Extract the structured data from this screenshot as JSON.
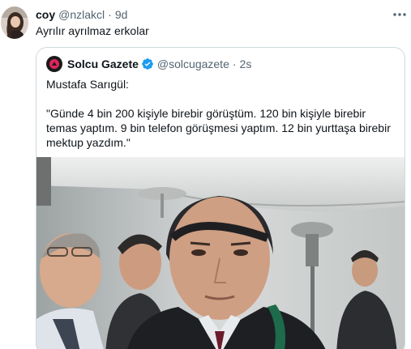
{
  "tweet": {
    "display_name": "coy",
    "handle": "@nzlakcl",
    "separator": "·",
    "time": "9d",
    "text": "Ayrılır ayrılmaz erkolar"
  },
  "quoted": {
    "display_name": "Solcu Gazete",
    "handle": "@solcugazete",
    "separator": "·",
    "time": "2s",
    "speaker": "Mustafa Sarıgül:",
    "quote": "\"Günde 4 bin 200 kişiyle birebir görüştüm. 120 bin kişiyle birebir temas yaptım. 9 bin telefon görüşmesi yaptım. 12 bin yurttaşa birebir mektup yazdım.\""
  },
  "colors": {
    "text": "#0f1419",
    "secondary": "#536471",
    "border": "#cfd9de",
    "verified": "#1d9bf0",
    "logo_red": "#e0245e"
  },
  "icons": {
    "more": "more-horizontal-icon",
    "verified": "verified-badge-icon"
  }
}
